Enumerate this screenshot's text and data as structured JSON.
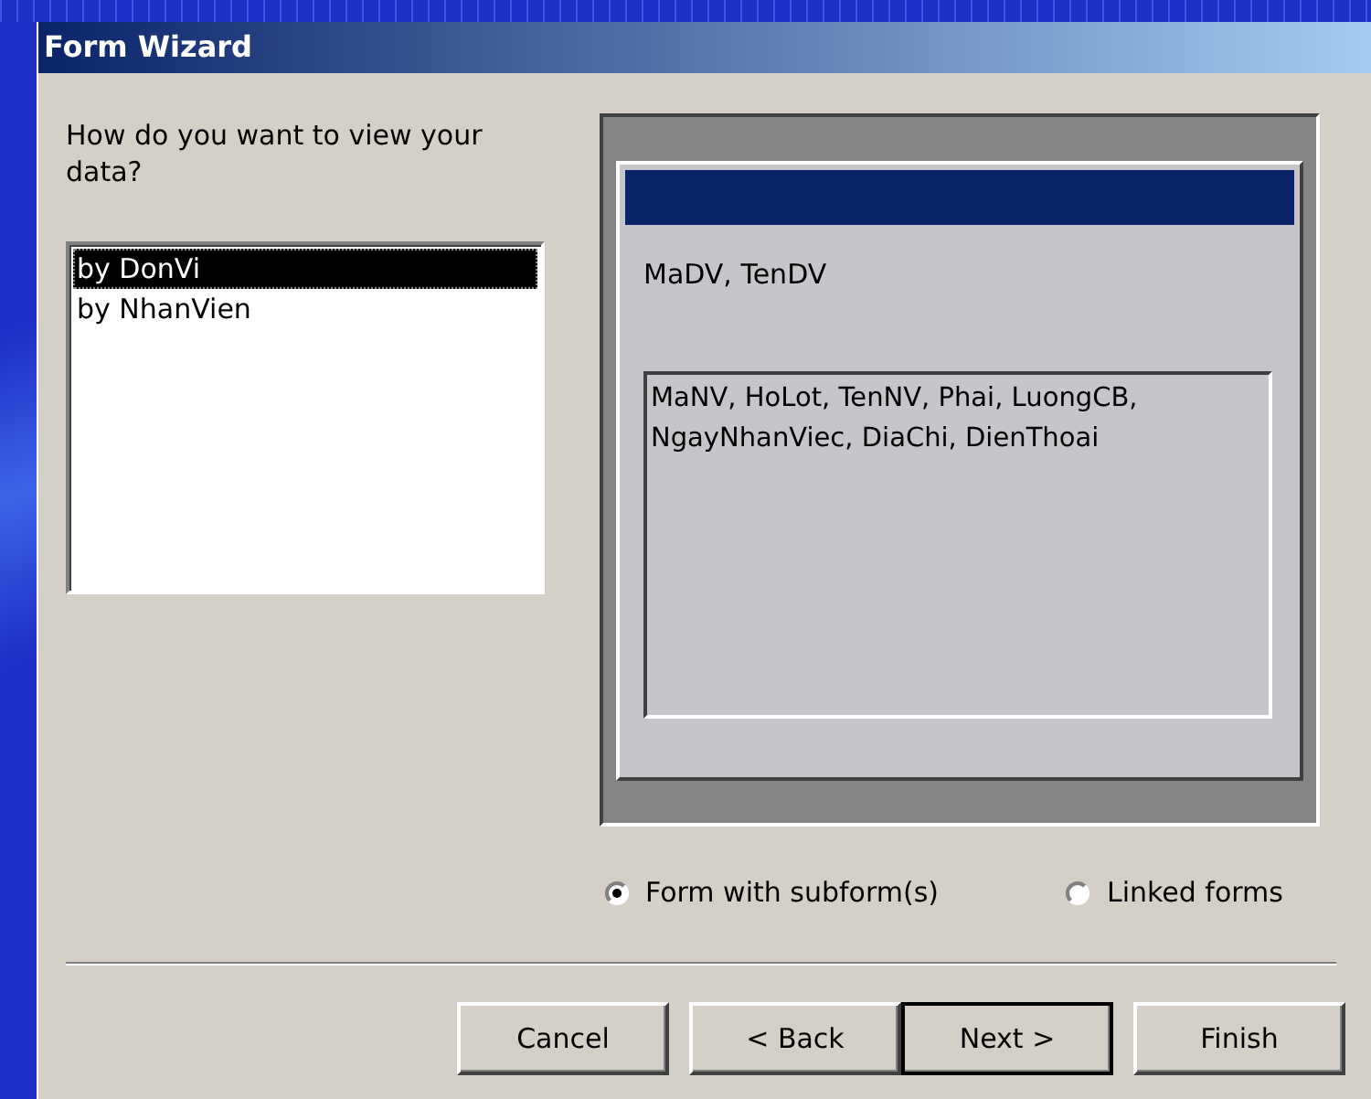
{
  "window": {
    "title": "Form Wizard"
  },
  "prompt": "How do you want to view your data?",
  "view_list": {
    "items": [
      {
        "label": "by DonVi",
        "selected": true
      },
      {
        "label": "by NhanVien",
        "selected": false
      }
    ]
  },
  "preview": {
    "main_fields": "MaDV, TenDV",
    "subform_fields": "MaNV, HoLot, TenNV, Phai, LuongCB, NgayNhanViec, DiaChi, DienThoai"
  },
  "layout_options": [
    {
      "label": "Form with subform(s)",
      "selected": true
    },
    {
      "label": "Linked forms",
      "selected": false
    }
  ],
  "buttons": [
    {
      "label": "Cancel",
      "default": false
    },
    {
      "label": "< Back",
      "default": false
    },
    {
      "label": "Next >",
      "default": true
    },
    {
      "label": "Finish",
      "default": false
    }
  ]
}
